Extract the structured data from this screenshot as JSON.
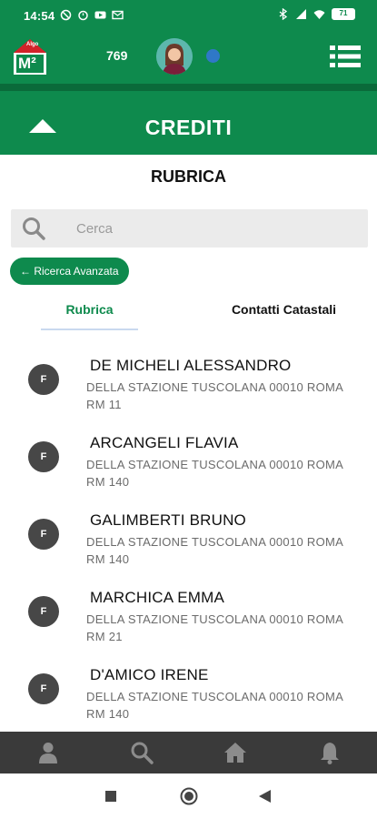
{
  "status_bar": {
    "time": "14:54",
    "battery": "71"
  },
  "app_bar": {
    "logo_badge": "Algo",
    "logo_text": "M²",
    "credits_count": "769"
  },
  "header": {
    "title": "CREDITI"
  },
  "page": {
    "subtitle": "RUBRICA"
  },
  "search": {
    "placeholder": "Cerca",
    "value": ""
  },
  "advanced_search": {
    "label": "← Ricerca Avanzata"
  },
  "tabs": [
    {
      "label": "Rubrica",
      "active": true
    },
    {
      "label": "Contatti Catastali",
      "active": false
    }
  ],
  "contacts": [
    {
      "badge": "F",
      "name": "DE MICHELI ALESSANDRO",
      "address": "DELLA STAZIONE TUSCOLANA 00010 ROMA RM 11"
    },
    {
      "badge": "F",
      "name": "ARCANGELI FLAVIA",
      "address": "DELLA STAZIONE TUSCOLANA 00010 ROMA RM 140"
    },
    {
      "badge": "F",
      "name": "GALIMBERTI BRUNO",
      "address": "DELLA STAZIONE TUSCOLANA 00010 ROMA RM 140"
    },
    {
      "badge": "F",
      "name": "MARCHICA EMMA",
      "address": "DELLA STAZIONE TUSCOLANA 00010 ROMA RM 21"
    },
    {
      "badge": "F",
      "name": "D'AMICO IRENE",
      "address": "DELLA STAZIONE TUSCOLANA 00010 ROMA RM 140"
    }
  ],
  "bottom_nav": [
    "person-icon",
    "search-icon",
    "home-icon",
    "bell-icon"
  ],
  "colors": {
    "primary": "#0e8a4d",
    "primary_dark": "#0a6a3a",
    "badge": "#474747",
    "presence": "#2f78c8",
    "bottom_nav": "#3a3a3a"
  }
}
